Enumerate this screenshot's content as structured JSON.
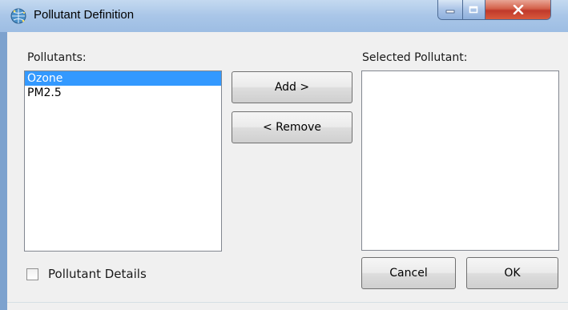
{
  "window": {
    "title": "Pollutant Definition",
    "controls": [
      "minimize",
      "maximize",
      "close"
    ]
  },
  "available": {
    "label": "Pollutants:",
    "items": [
      {
        "label": "Ozone",
        "selected": true
      },
      {
        "label": "PM2.5",
        "selected": false
      }
    ]
  },
  "selected": {
    "label": "Selected Pollutant:",
    "items": []
  },
  "buttons": {
    "add": "Add >",
    "remove": "< Remove",
    "cancel": "Cancel",
    "ok": "OK"
  },
  "details": {
    "label": "Pollutant Details",
    "checked": false
  },
  "colors": {
    "selection": "#3399ff",
    "titlebar": "#a9c6e8",
    "close_button": "#c0392b"
  }
}
